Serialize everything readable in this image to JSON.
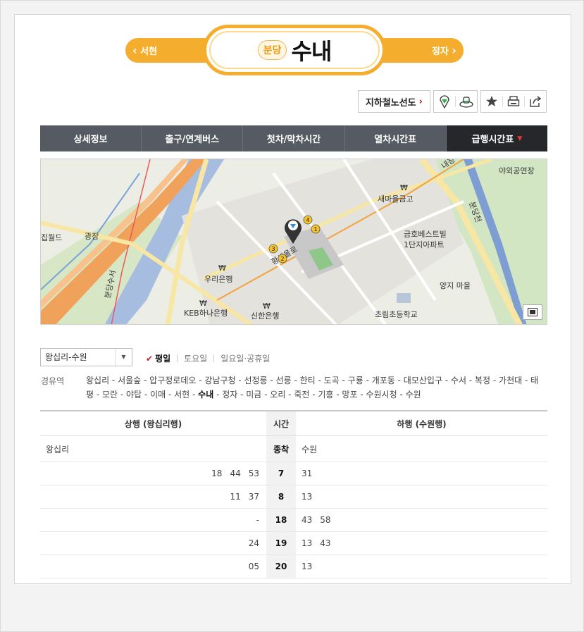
{
  "station": {
    "line_badge": "분당",
    "name": "수내",
    "prev": "서현",
    "next": "정자"
  },
  "tools": {
    "line_map": "지하철노선도"
  },
  "tabs": [
    {
      "label": "상세정보"
    },
    {
      "label": "출구/연계버스"
    },
    {
      "label": "첫차/막차시간"
    },
    {
      "label": "열차시간표"
    },
    {
      "label": "급행시간표",
      "active": true
    }
  ],
  "map": {
    "labels": {
      "world": "집월드",
      "plaza": "광장",
      "saemaeul": "새마을금고",
      "woori": "우리은행",
      "keb": "KEB하나은행",
      "shinhan": "신한은행",
      "kumho_a": "금호베스트빌",
      "kumho_b": "1단지아파트",
      "yangji": "양지 마을",
      "chorim": "초림초등학교",
      "outdoor": "야외공연장",
      "stream": "분당천",
      "road": "분당수서",
      "station_road": "황새울로",
      "naejeong": "내정"
    },
    "exits": [
      "1",
      "2",
      "3",
      "4"
    ]
  },
  "filter": {
    "direction": "왕십리-수원",
    "days": [
      "평일",
      "토요일",
      "일요일·공휴일"
    ]
  },
  "via": {
    "label": "경유역",
    "before": "왕십리 - 서울숲 - 압구정로데오 - 강남구청 - 선정릉 - 선릉 - 한티 - 도곡 - 구룡 - 개포동 - 대모산입구 - 수서 - 복정 - 가천대 - 태평 - 모란 - 야탑 - 이매 - 서현 - ",
    "current": "수내",
    "after": " - 정자 - 미금 - 오리 - 죽전 - 기흥 - 망포 - 수원시청 - 수원"
  },
  "timetable": {
    "headers": {
      "up": "상행 (왕십리행)",
      "time": "시간",
      "down": "하행 (수원행)"
    },
    "dest": {
      "up": "왕십리",
      "time": "종착",
      "down": "수원"
    },
    "rows": [
      {
        "hour": "7",
        "up": [
          "18",
          "44",
          "53"
        ],
        "down": [
          "31"
        ]
      },
      {
        "hour": "8",
        "up": [
          "11",
          "37"
        ],
        "down": [
          "13"
        ]
      },
      {
        "hour": "18",
        "up": [
          "-"
        ],
        "down": [
          "43",
          "58"
        ]
      },
      {
        "hour": "19",
        "up": [
          "24"
        ],
        "down": [
          "13",
          "43"
        ]
      },
      {
        "hour": "20",
        "up": [
          "05"
        ],
        "down": [
          "13"
        ]
      }
    ]
  }
}
